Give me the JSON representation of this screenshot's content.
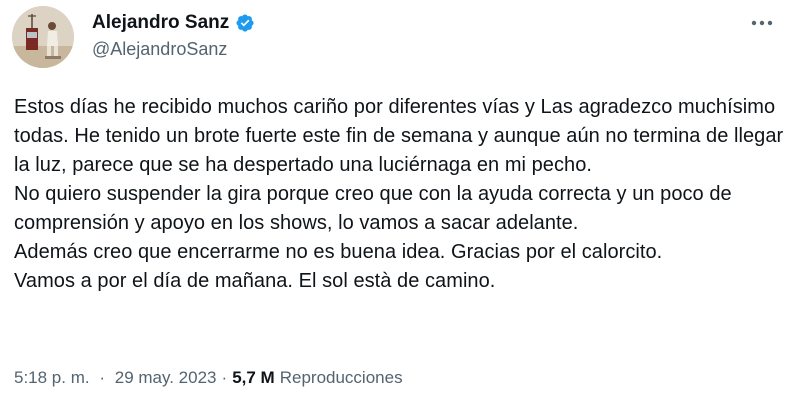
{
  "author": {
    "display_name": "Alejandro Sanz",
    "handle": "@AlejandroSanz",
    "verified": true,
    "verified_color": "#1d9bf0",
    "avatar_icon": "profile-photo"
  },
  "tweet": {
    "text": "Estos días he recibido muchos cariño por diferentes vías y Las agradezco muchísimo todas. He tenido un brote fuerte este fin de semana y aunque aún no termina de llegar la luz, parece que se ha despertado una luciérnaga en mi pecho.\nNo quiero suspender la gira porque creo que con la ayuda correcta y un poco de comprensión y apoyo en los shows, lo vamos a sacar adelante.\nAdemás creo que encerrarme no es buena idea. Gracias por el calorcito.\nVamos a por el día de mañana. El sol està de camino."
  },
  "meta": {
    "time": "5:18 p. m.",
    "separator": "·",
    "date": "29 may. 2023",
    "views_count": "5,7 M",
    "views_label": "Reproducciones"
  },
  "actions": {
    "more_icon": "more-horizontal-icon"
  },
  "colors": {
    "text_primary": "#0f1419",
    "text_secondary": "#536471",
    "accent": "#1d9bf0"
  }
}
